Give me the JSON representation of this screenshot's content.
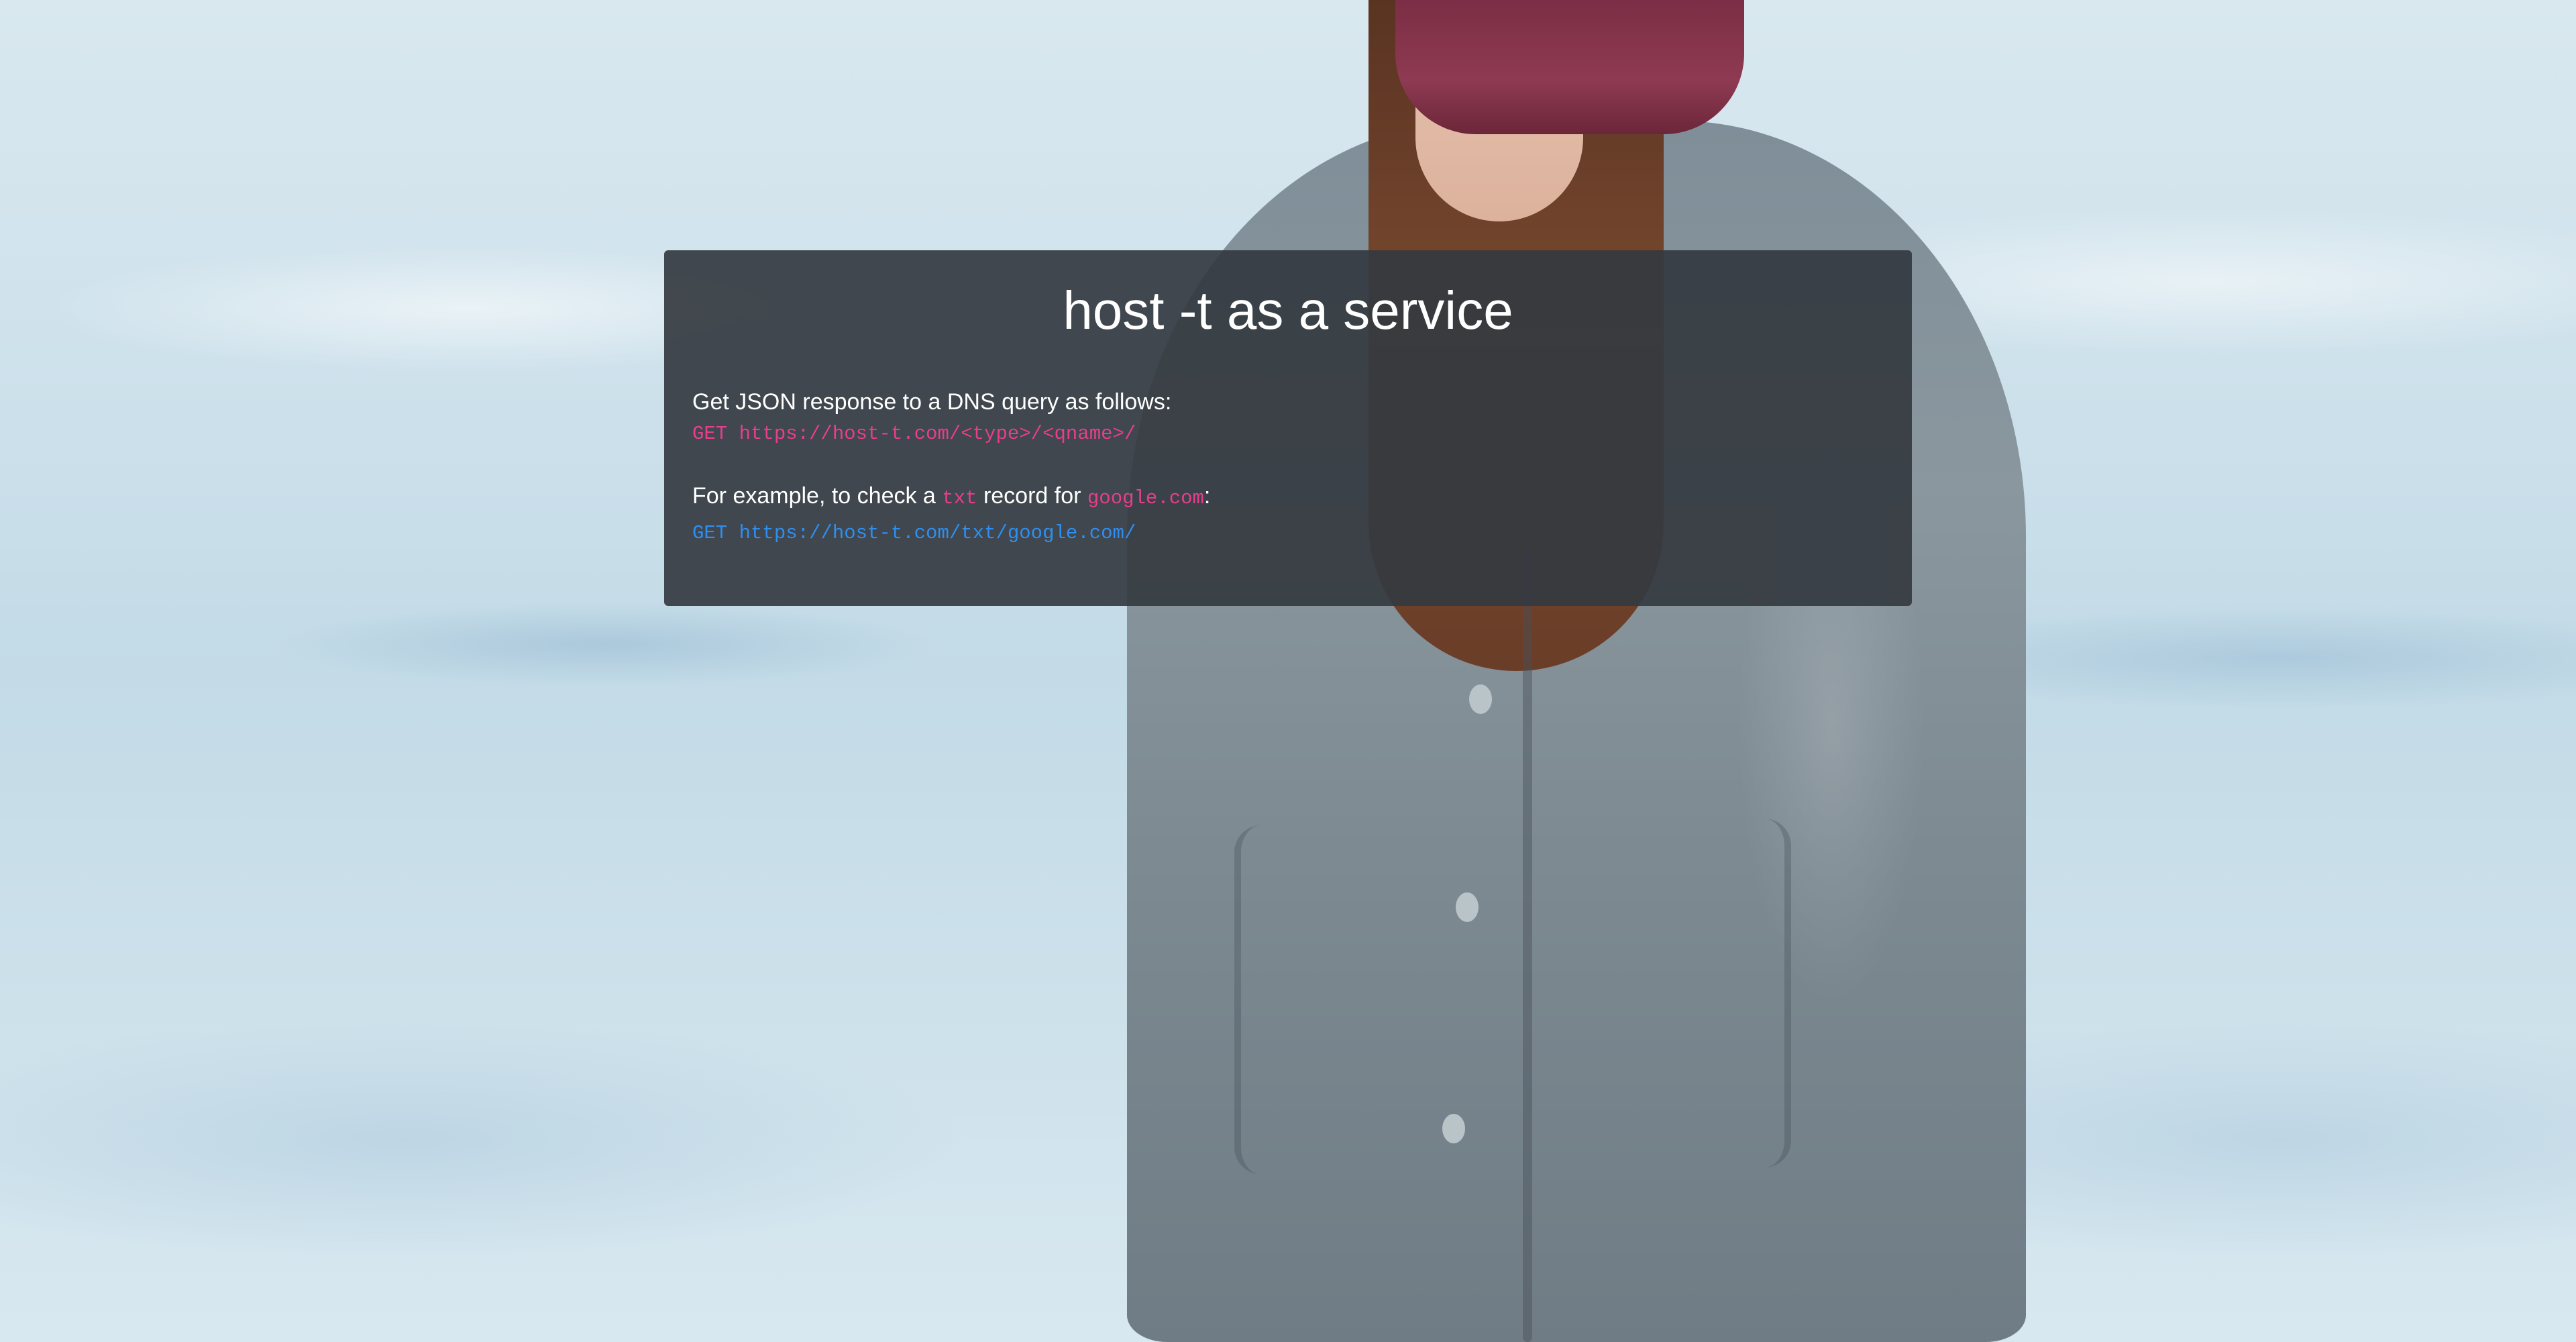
{
  "page": {
    "title": "host -t as a service",
    "intro": "Get JSON response to a DNS query as follows:",
    "usage_code": "GET https://host-t.com/<type>/<qname>/",
    "example_prefix": "For example, to check a ",
    "example_type": "txt",
    "example_middle": " record for ",
    "example_domain": "google.com",
    "example_suffix": ":",
    "example_link": "GET https://host-t.com/txt/google.com/"
  },
  "colors": {
    "panel_bg": "#343a40",
    "code_pink": "#e83e8c",
    "link_blue": "#2f8ff0"
  }
}
